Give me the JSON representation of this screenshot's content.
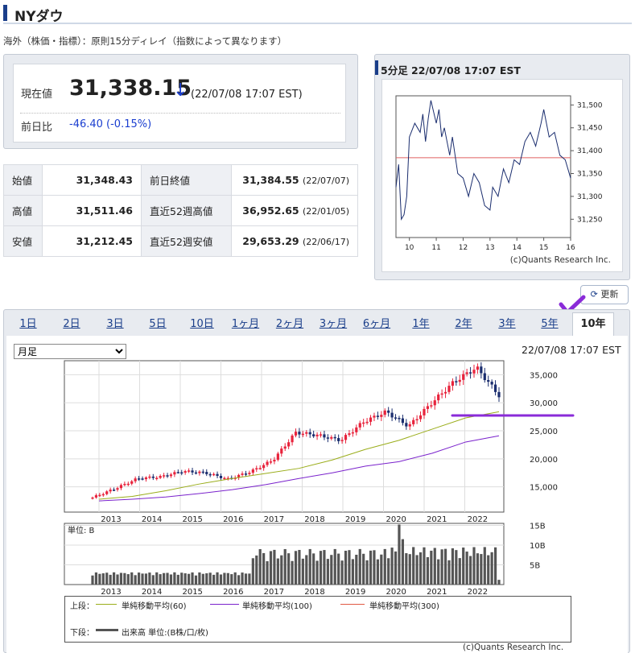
{
  "header": {
    "title": "NYダウ",
    "subtitle": "海外（株価・指標）：原則15分ディレイ（指数によって異なります）"
  },
  "price": {
    "current_label": "現在値",
    "current_value": "31,338.15",
    "arrow": "↓",
    "timestamp": "(22/07/08 17:07 EST)",
    "change_label": "前日比",
    "change_value": "-46.40 (-0.15%)"
  },
  "quote": {
    "open_label": "始値",
    "open_value": "31,348.43",
    "prev_close_label": "前日終値",
    "prev_close_value": "31,384.55",
    "prev_close_date": "(22/07/07)",
    "high_label": "高値",
    "high_value": "31,511.46",
    "high52_label": "直近52週高値",
    "high52_value": "36,952.65",
    "high52_date": "(22/01/05)",
    "low_label": "安値",
    "low_value": "31,212.45",
    "low52_label": "直近52週安値",
    "low52_value": "29,653.29",
    "low52_date": "(22/06/17)"
  },
  "intraday": {
    "title": "5分足 22/07/08 17:07 EST",
    "copyright": "(c)Quants Research Inc."
  },
  "refresh_label": "更新",
  "tabs": [
    "1日",
    "2日",
    "3日",
    "5日",
    "10日",
    "1ヶ月",
    "2ヶ月",
    "3ヶ月",
    "6ヶ月",
    "1年",
    "2年",
    "3年",
    "5年",
    "10年"
  ],
  "active_tab": "10年",
  "period_select": {
    "value": "月足"
  },
  "chart_timestamp": "22/07/08 17:07 EST",
  "volume_unit": "単位: B",
  "legend": {
    "upper_label": "上段：",
    "ma60": "単純移動平均(60)",
    "ma100": "単純移動平均(100)",
    "ma300": "単純移動平均(300)",
    "lower_label": "下段：",
    "volume": "出来高 単位:(B株/口/枚)"
  },
  "main_copyright": "(c)Quants Research Inc.",
  "colors": {
    "up": "#e8233c",
    "down": "#1a2d6e",
    "ma60": "#9aad1a",
    "ma100": "#7a22cc",
    "ma300": "#e05a44",
    "accent": "#1a3e8a",
    "annotation": "#8a2bd8"
  },
  "chart_data": [
    {
      "type": "line",
      "title": "5分足 22/07/08 17:07 EST",
      "x": [
        9.5,
        9.6,
        9.7,
        9.8,
        9.9,
        10.0,
        10.2,
        10.4,
        10.5,
        10.6,
        10.7,
        10.8,
        11.0,
        11.1,
        11.2,
        11.3,
        11.5,
        11.6,
        11.8,
        12.0,
        12.2,
        12.4,
        12.6,
        12.8,
        13.0,
        13.1,
        13.3,
        13.5,
        13.7,
        13.9,
        14.1,
        14.3,
        14.5,
        14.7,
        14.9,
        15.0,
        15.2,
        15.4,
        15.6,
        15.8,
        16.0
      ],
      "y": [
        31320,
        31370,
        31250,
        31260,
        31300,
        31430,
        31460,
        31440,
        31480,
        31420,
        31470,
        31510,
        31460,
        31490,
        31430,
        31450,
        31390,
        31430,
        31350,
        31340,
        31300,
        31350,
        31330,
        31280,
        31270,
        31320,
        31300,
        31360,
        31330,
        31380,
        31370,
        31420,
        31440,
        31410,
        31460,
        31490,
        31430,
        31440,
        31390,
        31380,
        31340
      ],
      "reference_y": 31384.55,
      "xlim": [
        9.5,
        16
      ],
      "ylim": [
        31210,
        31520
      ],
      "x_ticks": [
        "10",
        "11",
        "12",
        "13",
        "14",
        "15",
        "16"
      ],
      "y_ticks": [
        "31,250",
        "31,300",
        "31,350",
        "31,400",
        "31,450",
        "31,500"
      ]
    },
    {
      "type": "candlestick",
      "x_ticks": [
        "2013",
        "2014",
        "2015",
        "2016",
        "2017",
        "2018",
        "2019",
        "2020",
        "2021",
        "2022"
      ],
      "y_ticks": [
        "15,000",
        "20,000",
        "25,000",
        "30,000",
        "35,000"
      ],
      "ylim": [
        10500,
        37500
      ],
      "series": [
        {
          "name": "単純移動平均(60)",
          "values": [
            12800,
            13300,
            14300,
            15500,
            16500,
            17400,
            18300,
            19800,
            21700,
            23300,
            25300,
            27300,
            28400
          ]
        },
        {
          "name": "単純移動平均(100)",
          "values": [
            12500,
            12800,
            13200,
            13800,
            14500,
            15400,
            16500,
            17500,
            18700,
            19500,
            21000,
            23000,
            24100
          ]
        },
        {
          "name": "単純移動平均(300)",
          "values": []
        }
      ],
      "closes": [
        13100,
        14700,
        16500,
        16800,
        17800,
        17500,
        16400,
        17700,
        19800,
        24700,
        24200,
        23300,
        26600,
        28400,
        25800,
        29900,
        33700,
        36300,
        31300
      ],
      "volume_y_ticks": [
        "5B",
        "10B",
        "15B"
      ]
    }
  ]
}
